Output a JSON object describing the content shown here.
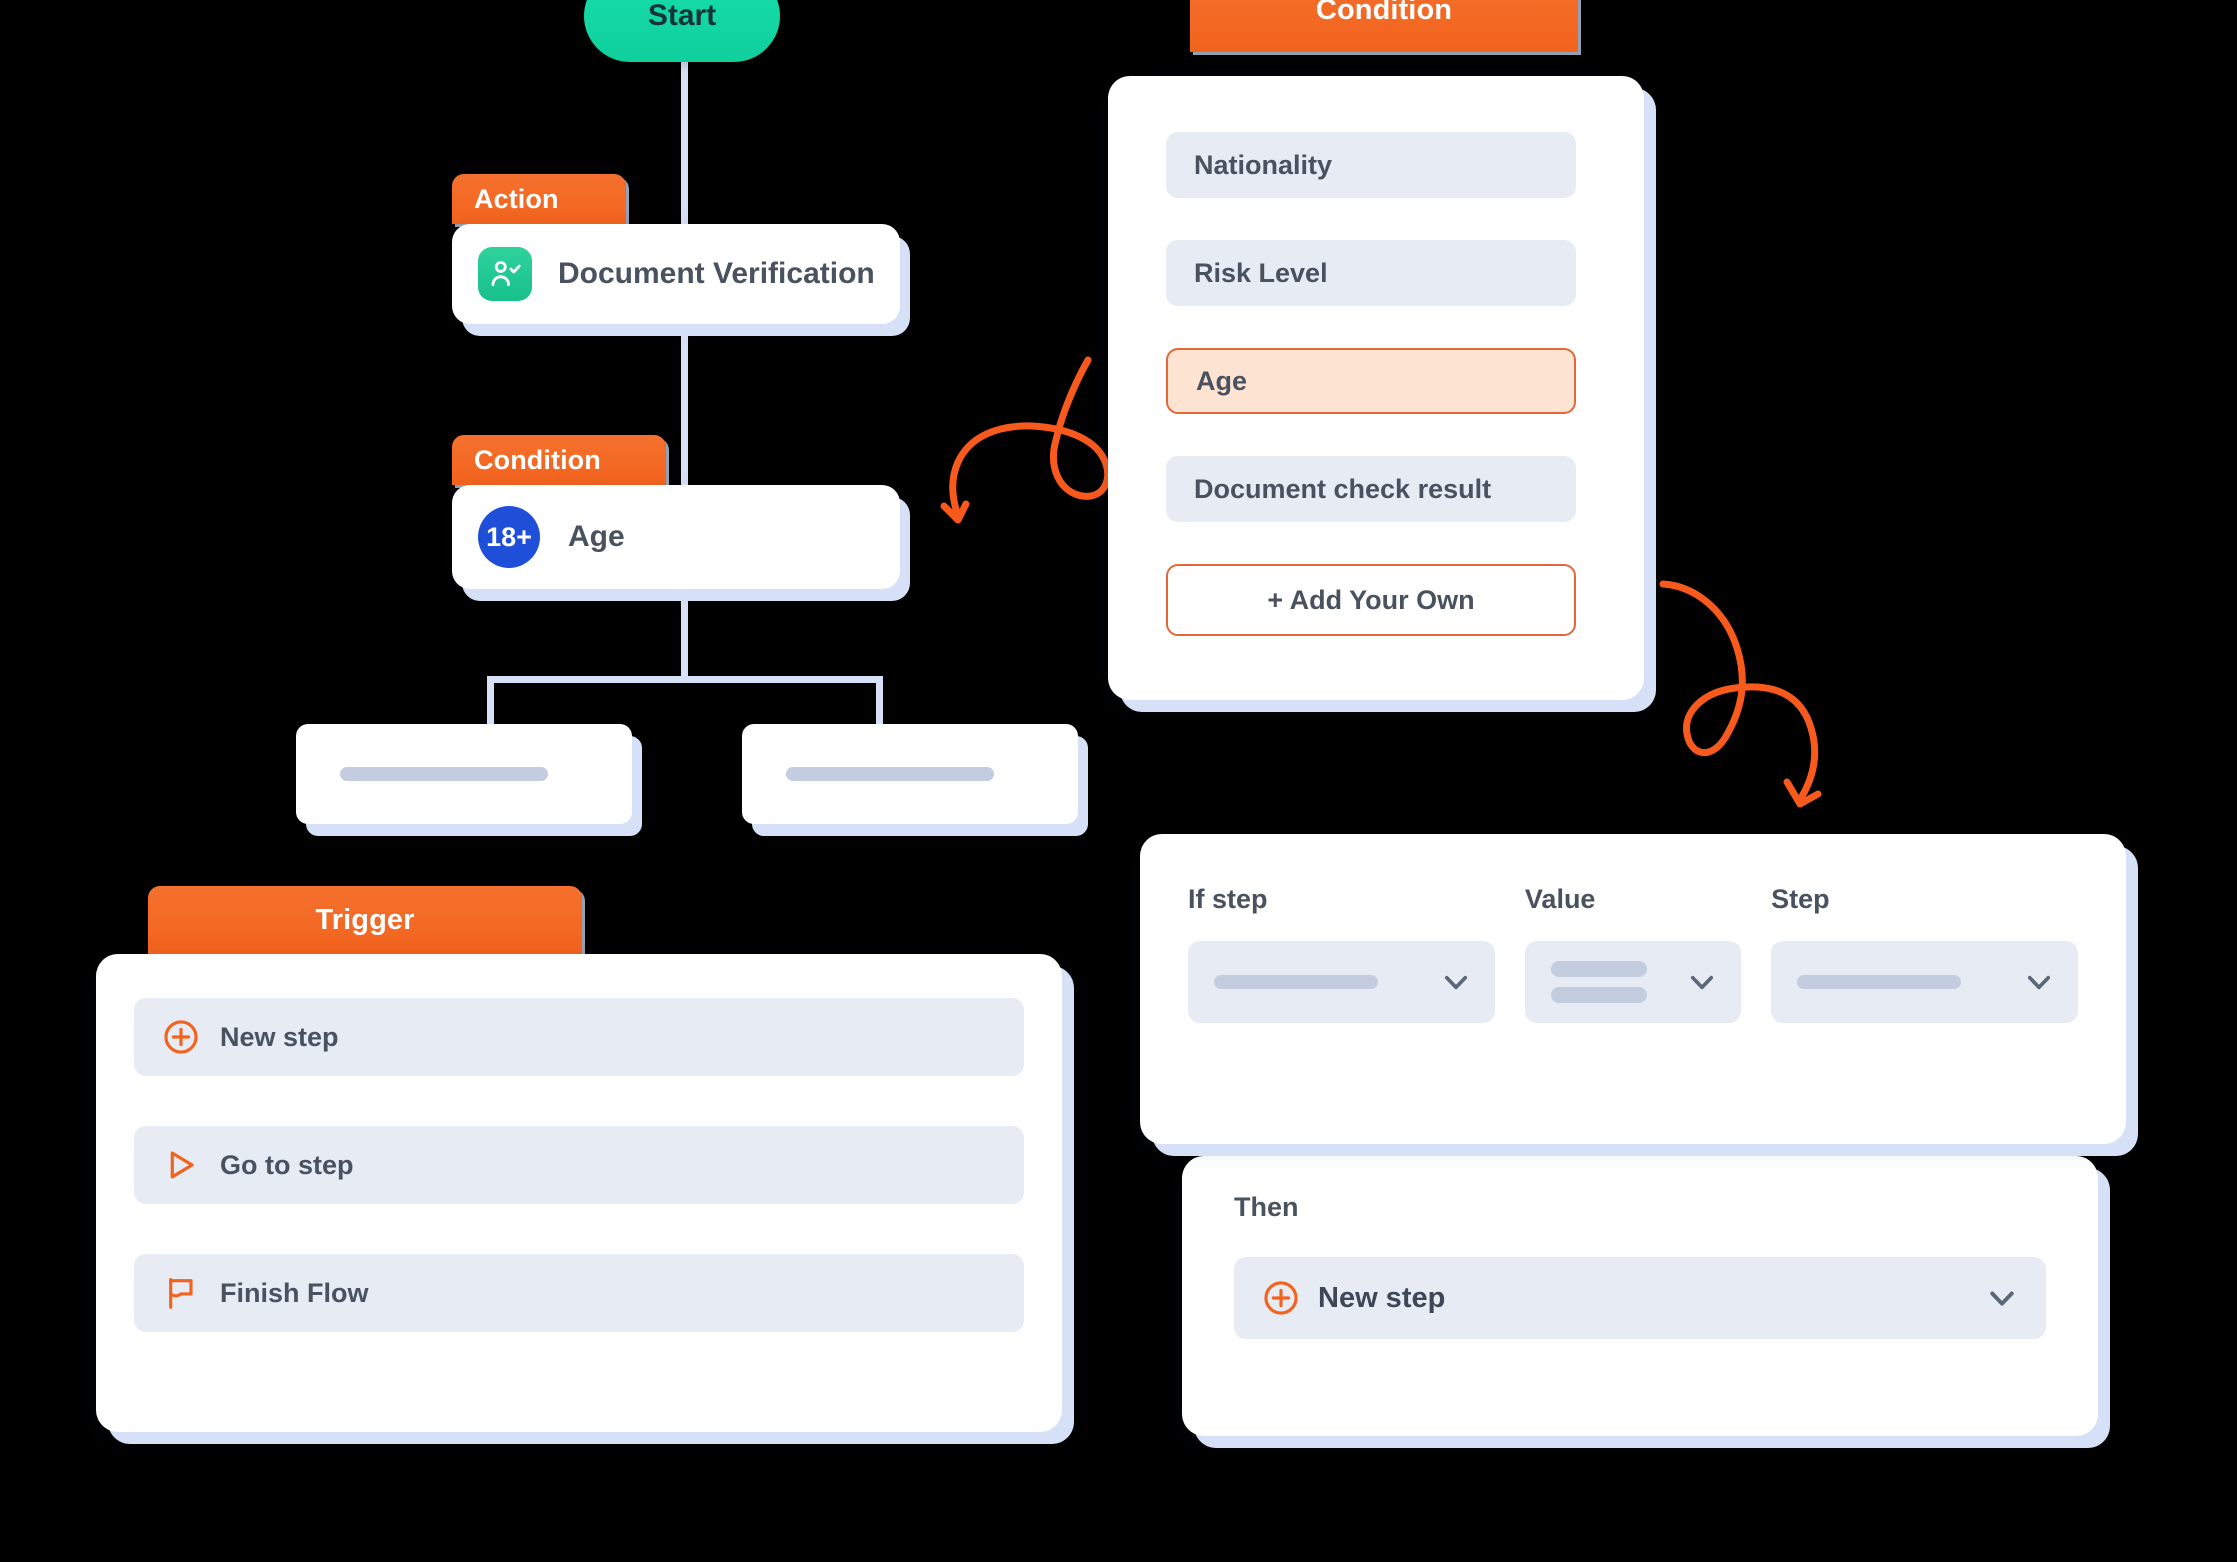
{
  "flow": {
    "start_label": "Start",
    "action": {
      "tab_label": "Action",
      "item_label": "Document Verification",
      "icon": "user-check-icon"
    },
    "condition": {
      "tab_label": "Condition",
      "badge_label": "18+",
      "item_label": "Age"
    },
    "branches": [
      {
        "placeholder": ""
      },
      {
        "placeholder": ""
      }
    ]
  },
  "condition_panel": {
    "tab_label": "Condition",
    "options": [
      {
        "label": "Nationality",
        "state": "default"
      },
      {
        "label": "Risk Level",
        "state": "default"
      },
      {
        "label": "Age",
        "state": "selected"
      },
      {
        "label": "Document check result",
        "state": "default"
      }
    ],
    "add_own_label": "+ Add Your Own"
  },
  "trigger_panel": {
    "tab_label": "Trigger",
    "items": [
      {
        "label": "New step",
        "icon": "plus-circle-icon"
      },
      {
        "label": "Go to step",
        "icon": "play-triangle-icon"
      },
      {
        "label": "Finish Flow",
        "icon": "flag-icon"
      }
    ]
  },
  "rule_panel": {
    "if_step_label": "If step",
    "value_label": "Value",
    "step_label": "Step",
    "if_step_value": "",
    "value_value": "",
    "step_value": "",
    "chevron_icon": "chevron-down-icon"
  },
  "then_panel": {
    "then_label": "Then",
    "new_step_label": "New step",
    "new_step_icon": "plus-circle-icon",
    "chevron_icon": "chevron-down-icon"
  },
  "colors": {
    "orange": "#f2631d",
    "orange_light": "#f4712e",
    "teal": "#0fcf9c",
    "blue_badge": "#1f4fd8",
    "shadow_blue": "#d6e1f7",
    "row_gray": "#e7ebf4",
    "selected_peach": "#fde3d2",
    "text_dark": "#4a5260"
  }
}
